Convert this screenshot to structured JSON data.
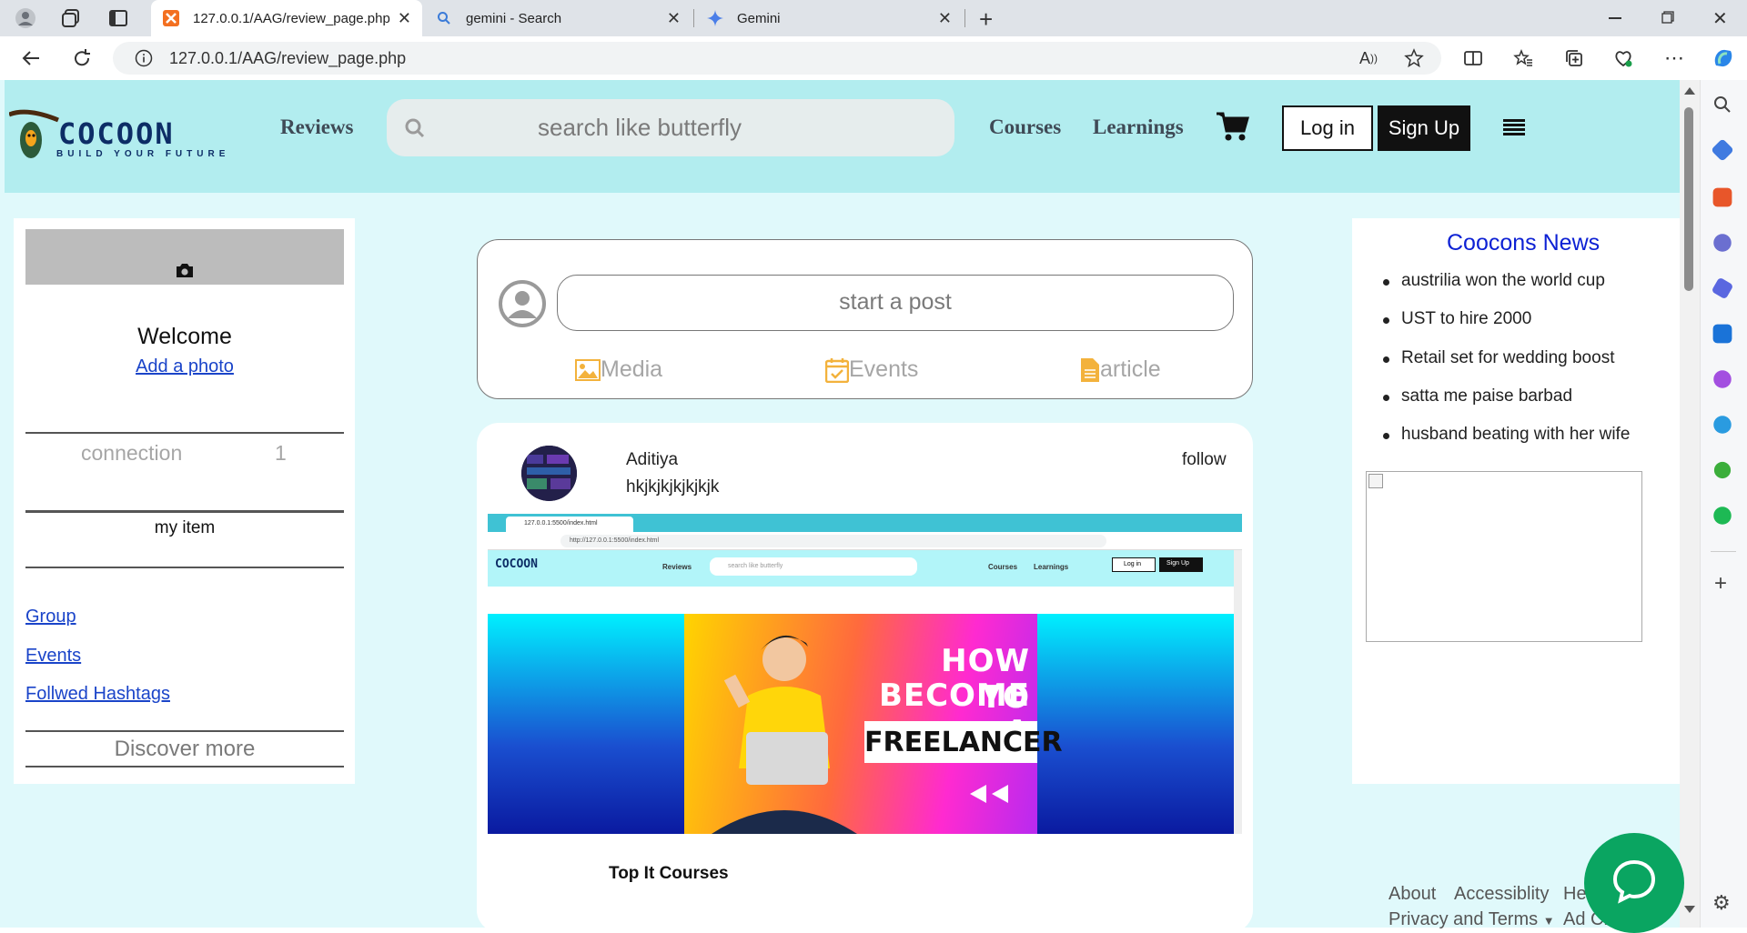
{
  "browser": {
    "tabs": [
      {
        "title": "127.0.0.1/AAG/review_page.php",
        "active": true
      },
      {
        "title": "gemini - Search",
        "active": false
      },
      {
        "title": "Gemini",
        "active": false
      }
    ],
    "url": "127.0.0.1/AAG/review_page.php"
  },
  "site": {
    "logo": {
      "name": "COCOON",
      "tagline": "BUILD YOUR FUTURE"
    },
    "nav": {
      "reviews": "Reviews",
      "search_placeholder": "search like butterfly",
      "courses": "Courses",
      "learnings": "Learnings",
      "login": "Log in",
      "signup": "Sign Up"
    }
  },
  "left_panel": {
    "welcome": "Welcome",
    "add_photo": "Add a photo",
    "connection_label": "connection",
    "connection_count": "1",
    "my_item": "my item",
    "links": [
      "Group",
      "Events",
      "Follwed Hashtags"
    ],
    "discover": "Discover more"
  },
  "composer": {
    "placeholder": "start a post",
    "options": [
      "Media",
      "Events",
      "article"
    ]
  },
  "post": {
    "author": "Aditiya",
    "text": "hkjkjkjkjkjkjk",
    "follow": "follow",
    "screenshot": {
      "url": "http://127.0.0.1:5500/index.html",
      "tab": "127.0.0.1:5500/index.html",
      "nav": [
        "Reviews",
        "Courses",
        "Learnings",
        "Log in",
        "Sign Up"
      ],
      "search": "search like butterfly",
      "banner": [
        "HOW TO",
        "BECOME A",
        "FREELANCER"
      ],
      "section_title": "Top It Courses"
    }
  },
  "news": {
    "title": "Coocons News",
    "items": [
      "austrilia won the world cup",
      "UST to hire 2000",
      "Retail set for wedding boost",
      "satta me paise barbad",
      "husband beating with her wife"
    ]
  },
  "footer": {
    "about": "About",
    "accessibility": "Accessiblity",
    "help": "Help Center",
    "privacy": "Privacy and Terms",
    "ad": "Ad Choices"
  },
  "colors": {
    "nav_bg": "#b2edef",
    "page_bg": "#e0f9fb",
    "news_title": "#0d21d4",
    "chat": "#0aa561"
  }
}
